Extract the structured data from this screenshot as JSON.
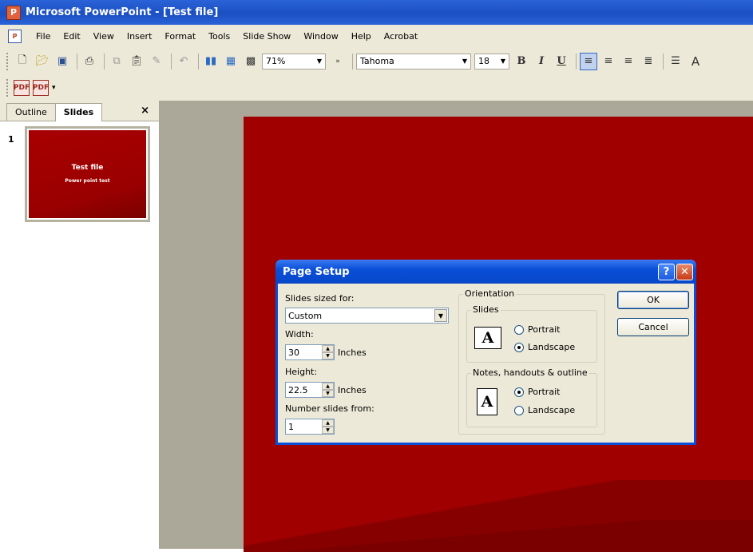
{
  "window": {
    "title": "Microsoft PowerPoint - [Test file]"
  },
  "menu": [
    "File",
    "Edit",
    "View",
    "Insert",
    "Format",
    "Tools",
    "Slide Show",
    "Window",
    "Help",
    "Acrobat"
  ],
  "toolbar": {
    "zoom": "71%",
    "font": "Tahoma",
    "size": "18"
  },
  "pane": {
    "tabs": [
      "Outline",
      "Slides"
    ],
    "active_tab": "Slides",
    "close": "×"
  },
  "thumbnail": {
    "number": "1",
    "title": "Test file",
    "subtitle": "Power point test"
  },
  "dialog": {
    "title": "Page Setup",
    "help": "?",
    "close": "✕",
    "slides_sized_for_label": "Slides sized for:",
    "slides_sized_for_value": "Custom",
    "width_label": "Width:",
    "width_value": "30",
    "height_label": "Height:",
    "height_value": "22.5",
    "units": "Inches",
    "number_from_label": "Number slides from:",
    "number_from_value": "1",
    "orientation_label": "Orientation",
    "slides_group_label": "Slides",
    "slides_portrait": "Portrait",
    "slides_landscape": "Landscape",
    "slides_selected": "Landscape",
    "notes_group_label": "Notes, handouts & outline",
    "notes_portrait": "Portrait",
    "notes_landscape": "Landscape",
    "notes_selected": "Portrait",
    "icon_letter": "A",
    "ok": "OK",
    "cancel": "Cancel"
  },
  "colors": {
    "titlebar": "#1b4fc2",
    "slide": "#a00000",
    "workspace": "#aca899"
  }
}
